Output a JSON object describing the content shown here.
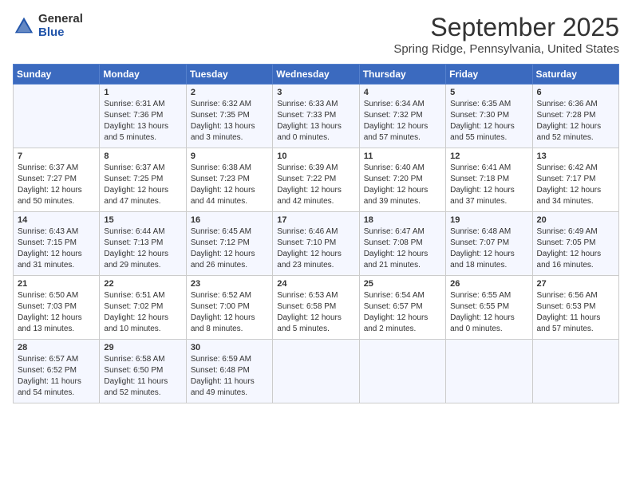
{
  "logo": {
    "general": "General",
    "blue": "Blue"
  },
  "title": "September 2025",
  "subtitle": "Spring Ridge, Pennsylvania, United States",
  "days_of_week": [
    "Sunday",
    "Monday",
    "Tuesday",
    "Wednesday",
    "Thursday",
    "Friday",
    "Saturday"
  ],
  "weeks": [
    [
      {
        "day": "",
        "detail": ""
      },
      {
        "day": "1",
        "detail": "Sunrise: 6:31 AM\nSunset: 7:36 PM\nDaylight: 13 hours\nand 5 minutes."
      },
      {
        "day": "2",
        "detail": "Sunrise: 6:32 AM\nSunset: 7:35 PM\nDaylight: 13 hours\nand 3 minutes."
      },
      {
        "day": "3",
        "detail": "Sunrise: 6:33 AM\nSunset: 7:33 PM\nDaylight: 13 hours\nand 0 minutes."
      },
      {
        "day": "4",
        "detail": "Sunrise: 6:34 AM\nSunset: 7:32 PM\nDaylight: 12 hours\nand 57 minutes."
      },
      {
        "day": "5",
        "detail": "Sunrise: 6:35 AM\nSunset: 7:30 PM\nDaylight: 12 hours\nand 55 minutes."
      },
      {
        "day": "6",
        "detail": "Sunrise: 6:36 AM\nSunset: 7:28 PM\nDaylight: 12 hours\nand 52 minutes."
      }
    ],
    [
      {
        "day": "7",
        "detail": "Sunrise: 6:37 AM\nSunset: 7:27 PM\nDaylight: 12 hours\nand 50 minutes."
      },
      {
        "day": "8",
        "detail": "Sunrise: 6:37 AM\nSunset: 7:25 PM\nDaylight: 12 hours\nand 47 minutes."
      },
      {
        "day": "9",
        "detail": "Sunrise: 6:38 AM\nSunset: 7:23 PM\nDaylight: 12 hours\nand 44 minutes."
      },
      {
        "day": "10",
        "detail": "Sunrise: 6:39 AM\nSunset: 7:22 PM\nDaylight: 12 hours\nand 42 minutes."
      },
      {
        "day": "11",
        "detail": "Sunrise: 6:40 AM\nSunset: 7:20 PM\nDaylight: 12 hours\nand 39 minutes."
      },
      {
        "day": "12",
        "detail": "Sunrise: 6:41 AM\nSunset: 7:18 PM\nDaylight: 12 hours\nand 37 minutes."
      },
      {
        "day": "13",
        "detail": "Sunrise: 6:42 AM\nSunset: 7:17 PM\nDaylight: 12 hours\nand 34 minutes."
      }
    ],
    [
      {
        "day": "14",
        "detail": "Sunrise: 6:43 AM\nSunset: 7:15 PM\nDaylight: 12 hours\nand 31 minutes."
      },
      {
        "day": "15",
        "detail": "Sunrise: 6:44 AM\nSunset: 7:13 PM\nDaylight: 12 hours\nand 29 minutes."
      },
      {
        "day": "16",
        "detail": "Sunrise: 6:45 AM\nSunset: 7:12 PM\nDaylight: 12 hours\nand 26 minutes."
      },
      {
        "day": "17",
        "detail": "Sunrise: 6:46 AM\nSunset: 7:10 PM\nDaylight: 12 hours\nand 23 minutes."
      },
      {
        "day": "18",
        "detail": "Sunrise: 6:47 AM\nSunset: 7:08 PM\nDaylight: 12 hours\nand 21 minutes."
      },
      {
        "day": "19",
        "detail": "Sunrise: 6:48 AM\nSunset: 7:07 PM\nDaylight: 12 hours\nand 18 minutes."
      },
      {
        "day": "20",
        "detail": "Sunrise: 6:49 AM\nSunset: 7:05 PM\nDaylight: 12 hours\nand 16 minutes."
      }
    ],
    [
      {
        "day": "21",
        "detail": "Sunrise: 6:50 AM\nSunset: 7:03 PM\nDaylight: 12 hours\nand 13 minutes."
      },
      {
        "day": "22",
        "detail": "Sunrise: 6:51 AM\nSunset: 7:02 PM\nDaylight: 12 hours\nand 10 minutes."
      },
      {
        "day": "23",
        "detail": "Sunrise: 6:52 AM\nSunset: 7:00 PM\nDaylight: 12 hours\nand 8 minutes."
      },
      {
        "day": "24",
        "detail": "Sunrise: 6:53 AM\nSunset: 6:58 PM\nDaylight: 12 hours\nand 5 minutes."
      },
      {
        "day": "25",
        "detail": "Sunrise: 6:54 AM\nSunset: 6:57 PM\nDaylight: 12 hours\nand 2 minutes."
      },
      {
        "day": "26",
        "detail": "Sunrise: 6:55 AM\nSunset: 6:55 PM\nDaylight: 12 hours\nand 0 minutes."
      },
      {
        "day": "27",
        "detail": "Sunrise: 6:56 AM\nSunset: 6:53 PM\nDaylight: 11 hours\nand 57 minutes."
      }
    ],
    [
      {
        "day": "28",
        "detail": "Sunrise: 6:57 AM\nSunset: 6:52 PM\nDaylight: 11 hours\nand 54 minutes."
      },
      {
        "day": "29",
        "detail": "Sunrise: 6:58 AM\nSunset: 6:50 PM\nDaylight: 11 hours\nand 52 minutes."
      },
      {
        "day": "30",
        "detail": "Sunrise: 6:59 AM\nSunset: 6:48 PM\nDaylight: 11 hours\nand 49 minutes."
      },
      {
        "day": "",
        "detail": ""
      },
      {
        "day": "",
        "detail": ""
      },
      {
        "day": "",
        "detail": ""
      },
      {
        "day": "",
        "detail": ""
      }
    ]
  ]
}
